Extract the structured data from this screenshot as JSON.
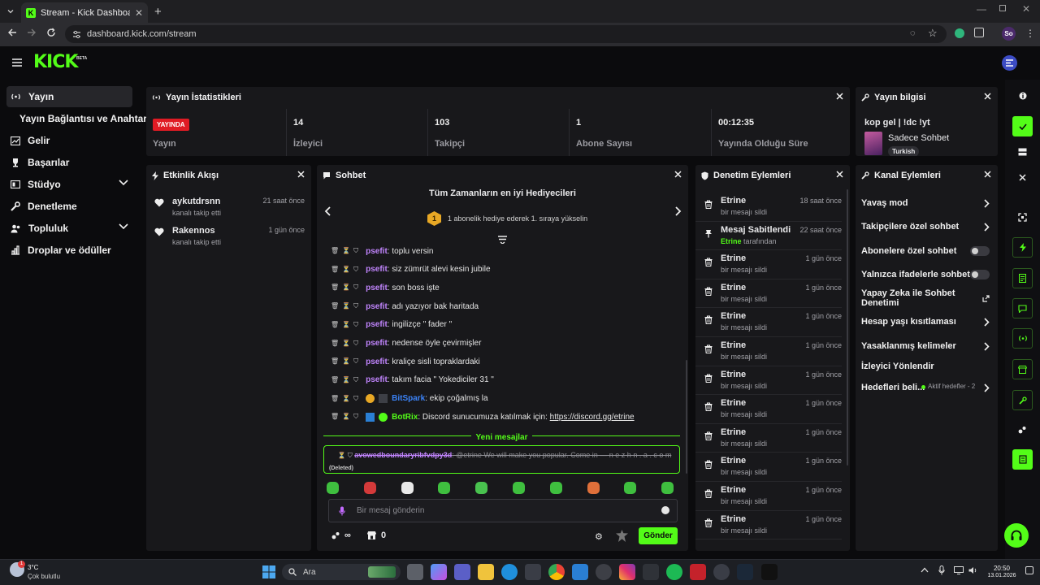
{
  "browser": {
    "tab_title": "Stream - Kick Dashboard",
    "url": "dashboard.kick.com/stream",
    "profile_initials": "So"
  },
  "brand": {
    "logo": "KICK",
    "badge": "BETA",
    "accent": "#53fc18"
  },
  "sidebar": {
    "items": [
      {
        "label": "Yayın",
        "icon": "broadcast-icon"
      },
      {
        "label": "Yayın Bağlantısı ve Anahtarı"
      },
      {
        "label": "Gelir",
        "icon": "revenue-icon"
      },
      {
        "label": "Başarılar",
        "icon": "trophy-icon"
      },
      {
        "label": "Stüdyo",
        "icon": "studio-icon"
      },
      {
        "label": "Denetleme",
        "icon": "wrench-icon"
      },
      {
        "label": "Topluluk",
        "icon": "community-icon"
      },
      {
        "label": "Droplar ve ödüller",
        "icon": "rewards-icon"
      }
    ]
  },
  "stats_panel": {
    "title": "Yayın İstatistikleri",
    "live": "YAYINDA",
    "status_label": "Yayın",
    "viewers": "14",
    "viewers_label": "İzleyici",
    "followers": "103",
    "followers_label": "Takipçi",
    "subs": "1",
    "subs_label": "Abone Sayısı",
    "uptime": "00:12:35",
    "uptime_label": "Yayında Olduğu Süre"
  },
  "info_panel": {
    "title": "Yayın bilgisi",
    "stream_title": "kop gel | !dc !yt",
    "category": "Sadece Sohbet",
    "language": "Turkish"
  },
  "activity_panel": {
    "title": "Etkinlik Akışı",
    "items": [
      {
        "name": "aykutdrsnn",
        "sub": "kanalı takip etti",
        "time": "21 saat önce"
      },
      {
        "name": "Rakennos",
        "sub": "kanalı takip etti",
        "time": "1 gün önce"
      }
    ]
  },
  "chat_panel": {
    "title": "Sohbet",
    "top_gifters_title": "Tüm Zamanların en iyi Hediyecileri",
    "rank": "1",
    "gift_prompt": "1 abonelik hediye ederek 1. sıraya yükselin",
    "messages": [
      {
        "user": "psefit",
        "text": ": toplu versin",
        "color": "#c084fc"
      },
      {
        "user": "psefit",
        "text": ": siz zümrüt alevi kesin jubile",
        "color": "#c084fc"
      },
      {
        "user": "psefit",
        "text": ": son boss işte",
        "color": "#c084fc"
      },
      {
        "user": "psefit",
        "text": ": adı yazıyor bak haritada",
        "color": "#c084fc"
      },
      {
        "user": "psefit",
        "text": ": ingilizçe \" fader \"",
        "color": "#c084fc"
      },
      {
        "user": "psefit",
        "text": ": nedense öyle çevirmişler",
        "color": "#c084fc"
      },
      {
        "user": "psefit",
        "text": ": kraliçe sisli topraklardaki",
        "color": "#c084fc"
      },
      {
        "user": "psefit",
        "text": ": takım facia \" Yokediciler 31 \"",
        "color": "#c084fc"
      },
      {
        "user": "BitSpark",
        "text": ": ekip çoğalmış la",
        "color": "#3b82f6"
      },
      {
        "user": "BotRix",
        "text": ": Discord sunucumuza katılmak için: ",
        "link": "https://discord.gg/etrine",
        "color": "#53fc18"
      }
    ],
    "new_messages": "Yeni mesajlar",
    "deleted_user": "avowedboundaryribfvdpy3d",
    "deleted_text": ": @etrine We will make you popular. Come in — n e z h n . a . c o m",
    "deleted_tag": "(Deleted)",
    "input_placeholder": "Bir mesaj gönderin",
    "points": "∞",
    "shop_count": "0",
    "send_label": "Gönder"
  },
  "moderation_panel": {
    "title": "Denetim Eylemleri",
    "items": [
      {
        "name": "Etrine",
        "sub": "bir mesajı sildi",
        "time": "18 saat önce",
        "icon": "trash-icon"
      },
      {
        "name": "Mesaj Sabitlendi",
        "sub_by": "Etrine",
        "sub": " tarafından",
        "time": "22 saat önce",
        "icon": "pin-icon"
      },
      {
        "name": "Etrine",
        "sub": "bir mesajı sildi",
        "time": "1 gün önce",
        "icon": "trash-icon"
      },
      {
        "name": "Etrine",
        "sub": "bir mesajı sildi",
        "time": "1 gün önce",
        "icon": "trash-icon"
      },
      {
        "name": "Etrine",
        "sub": "bir mesajı sildi",
        "time": "1 gün önce",
        "icon": "trash-icon"
      },
      {
        "name": "Etrine",
        "sub": "bir mesajı sildi",
        "time": "1 gün önce",
        "icon": "trash-icon"
      },
      {
        "name": "Etrine",
        "sub": "bir mesajı sildi",
        "time": "1 gün önce",
        "icon": "trash-icon"
      },
      {
        "name": "Etrine",
        "sub": "bir mesajı sildi",
        "time": "1 gün önce",
        "icon": "trash-icon"
      },
      {
        "name": "Etrine",
        "sub": "bir mesajı sildi",
        "time": "1 gün önce",
        "icon": "trash-icon"
      },
      {
        "name": "Etrine",
        "sub": "bir mesajı sildi",
        "time": "1 gün önce",
        "icon": "trash-icon"
      },
      {
        "name": "Etrine",
        "sub": "bir mesajı sildi",
        "time": "1 gün önce",
        "icon": "trash-icon"
      },
      {
        "name": "Etrine",
        "sub": "bir mesajı sildi",
        "time": "1 gün önce",
        "icon": "trash-icon"
      }
    ]
  },
  "channel_panel": {
    "title": "Kanal Eylemleri",
    "slow_mode": "Yavaş mod",
    "followers_only": "Takipçilere özel sohbet",
    "subs_only": "Abonelere özel sohbet",
    "emotes_only": "Yalnızca ifadelerle sohbet",
    "ai_moderation": "Yapay Zeka ile Sohbet Denetimi",
    "account_age": "Hesap yaşı kısıtlaması",
    "banned_words": "Yasaklanmış kelimeler",
    "viewer_director": "İzleyici Yönlendir",
    "goals": "Hedefleri beli...",
    "goals_status": "Aktif hedefler - 2"
  },
  "taskbar": {
    "weather_temp": "3°C",
    "weather_desc": "Çok bulutlu",
    "search": "Ara",
    "time": "20:50",
    "date": "13.01.2026"
  }
}
